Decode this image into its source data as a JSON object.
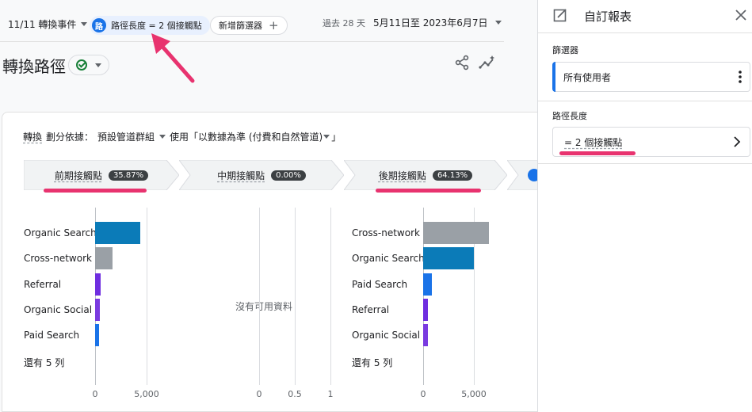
{
  "topbar": {
    "conversion_event": "11/11 轉換事件",
    "filter_chip_avatar": "路",
    "filter_chip_label": "路徑長度 = 2 個接觸點",
    "add_filter_label": "新增篩選器",
    "add_filter_plus": "+",
    "date_prefix": "過去 28 天",
    "date_range": "5月11日至 2023年6月7日"
  },
  "page": {
    "title": "轉換路徑"
  },
  "breakdown": {
    "conv_label": "轉換",
    "split_label": "劃分依據：",
    "channel_group": "預設管道群組",
    "model_text": "使用「以數據為準 (付費和自然管道)"
  },
  "stages": [
    {
      "label": "前期接觸點",
      "pct": "35.87%"
    },
    {
      "label": "中期接觸點",
      "pct": "0.00%"
    },
    {
      "label": "後期接觸點",
      "pct": "64.13%"
    }
  ],
  "no_data_text": "沒有可用資料",
  "chart_data": [
    {
      "type": "bar",
      "orientation": "horizontal",
      "categories": [
        "Organic Search",
        "Cross-network",
        "Referral",
        "Organic Social",
        "Paid Search"
      ],
      "values": [
        4400,
        1700,
        500,
        480,
        420
      ],
      "colors": [
        "#0b7bb8",
        "#9aa0a6",
        "#6f2ee0",
        "#7a3be0",
        "#1a73e8"
      ],
      "more_rows": "還有 5 列",
      "xticks": [
        "0",
        "5,000"
      ],
      "xlim": [
        0,
        5000
      ]
    },
    {
      "type": "bar",
      "orientation": "horizontal",
      "categories": [],
      "values": [],
      "xticks": [
        "0",
        "0.5",
        "1"
      ],
      "xlim": [
        0,
        1
      ]
    },
    {
      "type": "bar",
      "orientation": "horizontal",
      "categories": [
        "Cross-network",
        "Organic Search",
        "Paid Search",
        "Referral",
        "Organic Social"
      ],
      "values": [
        6500,
        5000,
        850,
        450,
        430
      ],
      "colors": [
        "#9aa0a6",
        "#0b7bb8",
        "#1a73e8",
        "#6f2ee0",
        "#7a3be0"
      ],
      "more_rows": "還有 5 列",
      "xticks": [
        "0",
        "5,000"
      ],
      "xlim": [
        0,
        5000
      ]
    }
  ],
  "panel": {
    "title": "自訂報表",
    "filter_section_label": "篩選器",
    "segment_value": "所有使用者",
    "path_length_section_label": "路徑長度",
    "path_length_value": "= 2 個接觸點"
  },
  "colors": {
    "accent": "#1a73e8",
    "annotation": "#e8336f"
  }
}
